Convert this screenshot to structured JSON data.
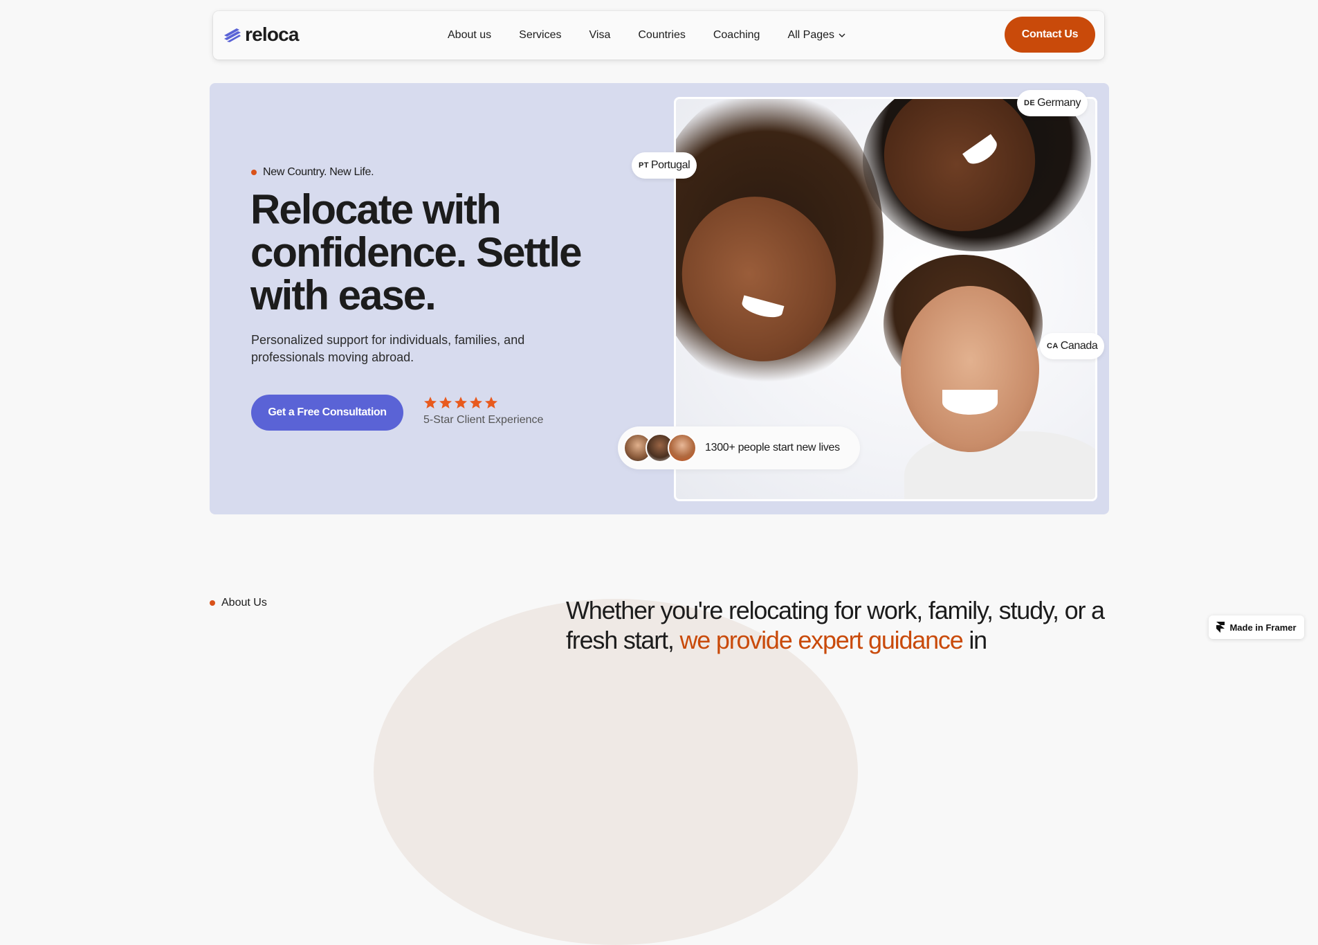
{
  "brand": {
    "name": "reloca"
  },
  "nav": {
    "links": [
      "About us",
      "Services",
      "Visa",
      "Countries",
      "Coaching",
      "All Pages"
    ],
    "contact_label": "Contact Us"
  },
  "hero": {
    "eyebrow": "New Country. New Life.",
    "headline": "Relocate with confidence. Settle with ease.",
    "subtext": "Personalized support for individuals, families, and professionals moving abroad.",
    "cta_label": "Get a Free Consultation",
    "rating": {
      "stars": 5,
      "text": "5-Star Client Experience"
    },
    "countries": [
      {
        "code": "DE",
        "name": "Germany"
      },
      {
        "code": "PT",
        "name": "Portugal"
      },
      {
        "code": "CA",
        "name": "Canada"
      }
    ],
    "social_proof": "1300+ people start new lives"
  },
  "about": {
    "label": "About Us",
    "heading_start": "Whether you're relocating for work, family, study, or a fresh start,",
    "heading_accent": "we provide expert guidance",
    "heading_end": "in"
  },
  "badge": {
    "label": "Made in Framer"
  },
  "colors": {
    "accent": "#c94a0a",
    "primary": "#5a63d6",
    "hero_bg": "#d7dbee",
    "page_bg": "#f8f8f8"
  }
}
